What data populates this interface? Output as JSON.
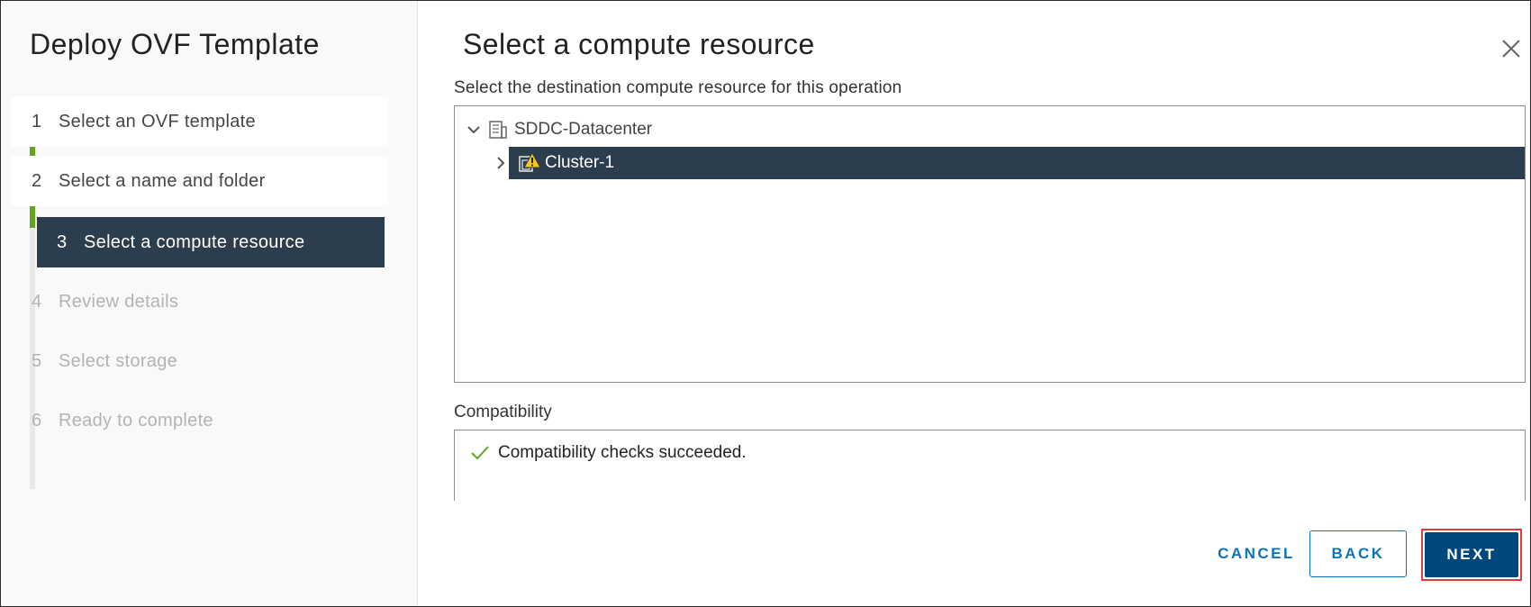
{
  "wizard": {
    "title": "Deploy OVF Template",
    "steps": [
      {
        "num": "1",
        "label": "Select an OVF template",
        "state": "done"
      },
      {
        "num": "2",
        "label": "Select a name and folder",
        "state": "done"
      },
      {
        "num": "3",
        "label": "Select a compute resource",
        "state": "current"
      },
      {
        "num": "4",
        "label": "Review details",
        "state": "todo"
      },
      {
        "num": "5",
        "label": "Select storage",
        "state": "todo"
      },
      {
        "num": "6",
        "label": "Ready to complete",
        "state": "todo"
      }
    ]
  },
  "main": {
    "title": "Select a compute resource",
    "subtitle": "Select the destination compute resource for this operation",
    "tree": {
      "datacenter": {
        "label": "SDDC-Datacenter",
        "icon": "datacenter-icon",
        "expanded": true
      },
      "cluster": {
        "label": "Cluster-1",
        "icon": "cluster-warning-icon",
        "selected": true,
        "expanded": false
      }
    },
    "compatibility": {
      "label": "Compatibility",
      "message": "Compatibility checks succeeded.",
      "status_icon": "check-icon"
    }
  },
  "buttons": {
    "cancel": "CANCEL",
    "back": "BACK",
    "next": "NEXT"
  },
  "colors": {
    "accent": "#0a74b9",
    "primary": "#00477e",
    "selected_bg": "#2c3e4d",
    "progress": "#62a420",
    "highlight": "#e03c3c",
    "success": "#62a420",
    "warning": "#f5c518"
  }
}
